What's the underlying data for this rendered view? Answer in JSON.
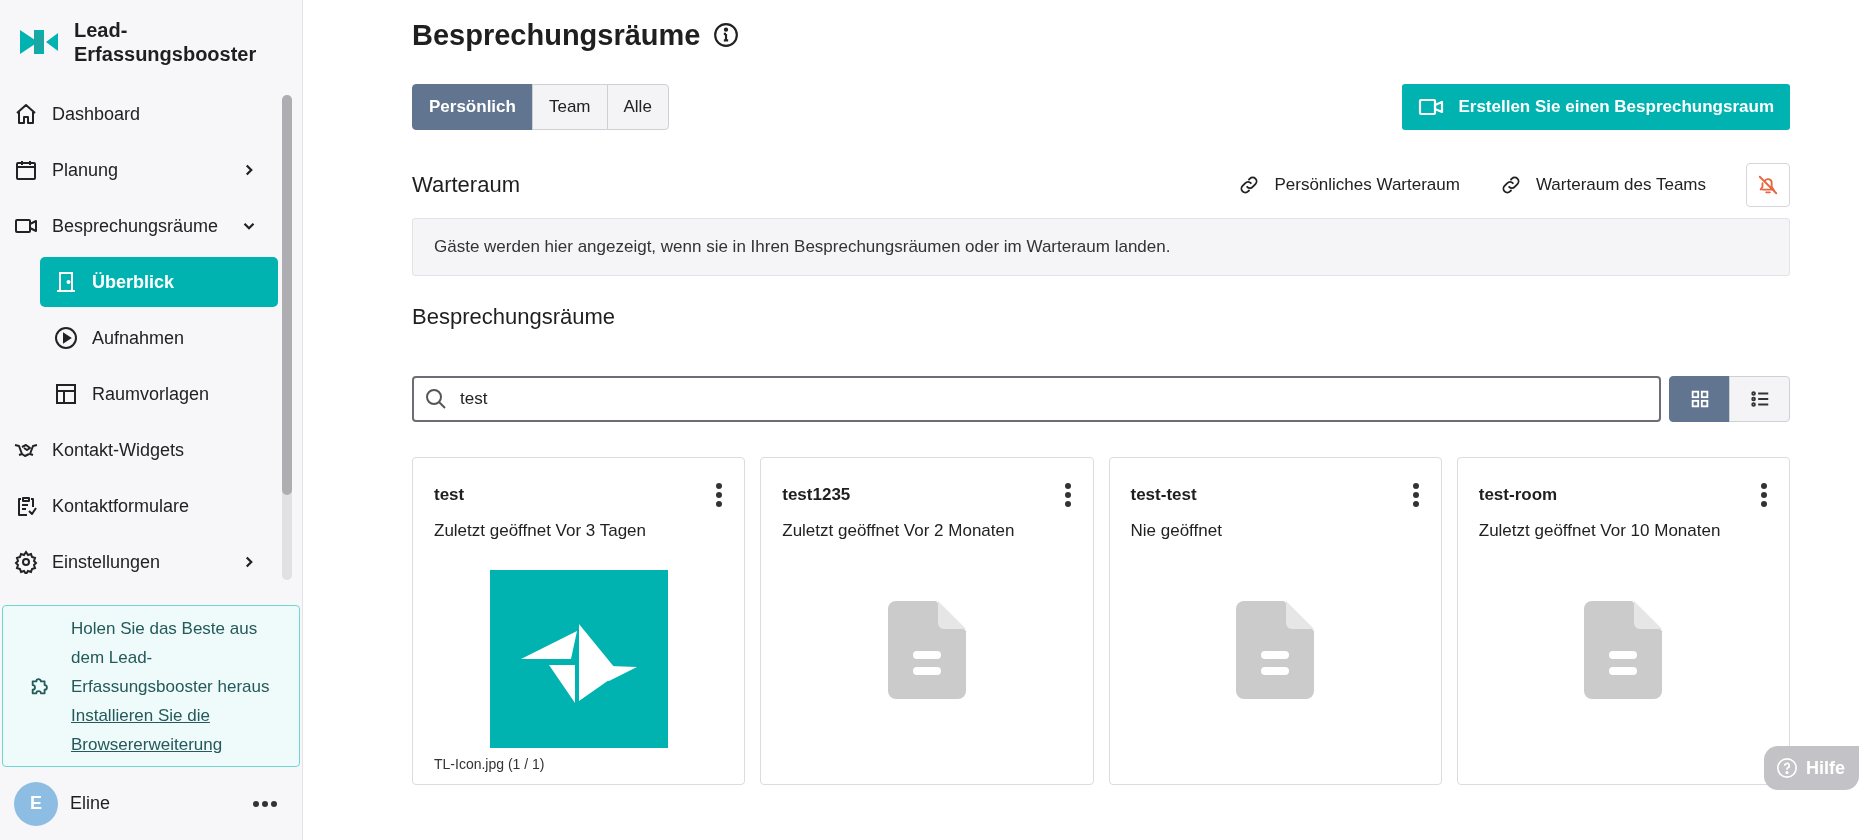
{
  "sidebar": {
    "brand": "Lead-Erfassungsbooster",
    "nav": [
      {
        "label": "Dashboard",
        "selected": false
      },
      {
        "label": "Planung",
        "selected": false,
        "expanded": false
      },
      {
        "label": "Besprechungsräume",
        "selected": false,
        "expanded": true,
        "children": [
          {
            "label": "Überblick",
            "selected": true
          },
          {
            "label": "Aufnahmen",
            "selected": false
          },
          {
            "label": "Raumvorlagen",
            "selected": false
          }
        ]
      },
      {
        "label": "Kontakt-Widgets",
        "selected": false
      },
      {
        "label": "Kontaktformulare",
        "selected": false
      },
      {
        "label": "Einstellungen",
        "selected": false,
        "expanded": false
      }
    ],
    "promo": {
      "text": "Holen Sie das Beste aus dem Lead-Erfassungsbooster heraus",
      "link": "Installieren Sie die Browsererweiterung"
    },
    "user": {
      "initial": "E",
      "name": "Eline"
    }
  },
  "main": {
    "title": "Besprechungsräume",
    "tabs": [
      {
        "label": "Persönlich",
        "selected": true
      },
      {
        "label": "Team",
        "selected": false
      },
      {
        "label": "Alle",
        "selected": false
      }
    ],
    "create_button": "Erstellen Sie einen Besprechungsraum",
    "waiting_room": {
      "heading": "Warteraum",
      "links": [
        "Persönliches Warteraum",
        "Warteraum des Teams"
      ],
      "notice": "Gäste werden hier angezeigt, wenn sie in Ihren Besprechungsräumen oder im Warteraum landen."
    },
    "rooms_heading": "Besprechungsräume",
    "search": {
      "value": "test"
    },
    "view_toggle": [
      {
        "selected": true
      },
      {
        "selected": false
      }
    ],
    "cards": [
      {
        "title": "test",
        "subtitle": "Zuletzt geöffnet Vor 3 Tagen",
        "kind": "image",
        "caption": "TL-Icon.jpg (1 / 1)"
      },
      {
        "title": "test1235",
        "subtitle": "Zuletzt geöffnet Vor 2 Monaten",
        "kind": "document"
      },
      {
        "title": "test-test",
        "subtitle": "Nie geöffnet",
        "kind": "document"
      },
      {
        "title": "test-room",
        "subtitle": "Zuletzt geöffnet Vor 10 Monaten",
        "kind": "document"
      }
    ]
  },
  "help_button": "Hilfe"
}
